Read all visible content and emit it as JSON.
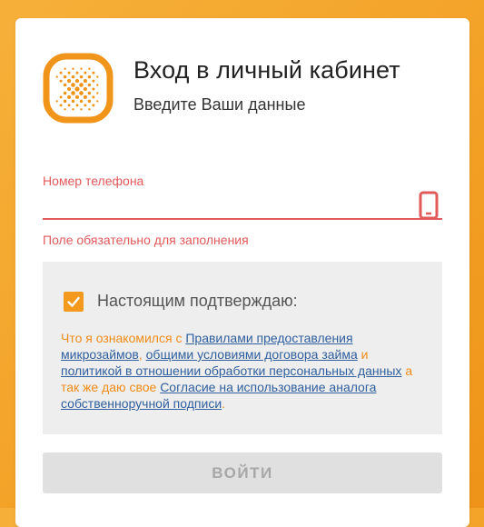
{
  "header": {
    "title": "Вход в личный кабинет",
    "subtitle": "Введите Ваши данные"
  },
  "form": {
    "phone_label": "Номер телефона",
    "phone_value": "",
    "phone_error": "Поле обязательно для заполнения"
  },
  "consent": {
    "checkbox_checked": true,
    "title": "Настоящим подтверждаю:",
    "text_1": "Что я ознакомился с ",
    "link_1": "Правилами предоставления микрозаймов",
    "text_2": ", ",
    "link_2": "общими условиями договора займа",
    "text_3": " и ",
    "link_3": "политикой в отношении обработки персональных данных",
    "text_4": " а так же даю свое ",
    "link_4": "Согласие на использование аналога собственноручной подписи",
    "text_5": "."
  },
  "actions": {
    "login_label": "ВОЙТИ"
  },
  "colors": {
    "accent": "#f39a1e",
    "error": "#e25a5a",
    "link": "#2f5f9e",
    "disabled_button": "#e0e0e0"
  },
  "icons": {
    "logo": "brand-logo-icon",
    "phone": "mobile-phone-icon",
    "check": "check-icon"
  }
}
